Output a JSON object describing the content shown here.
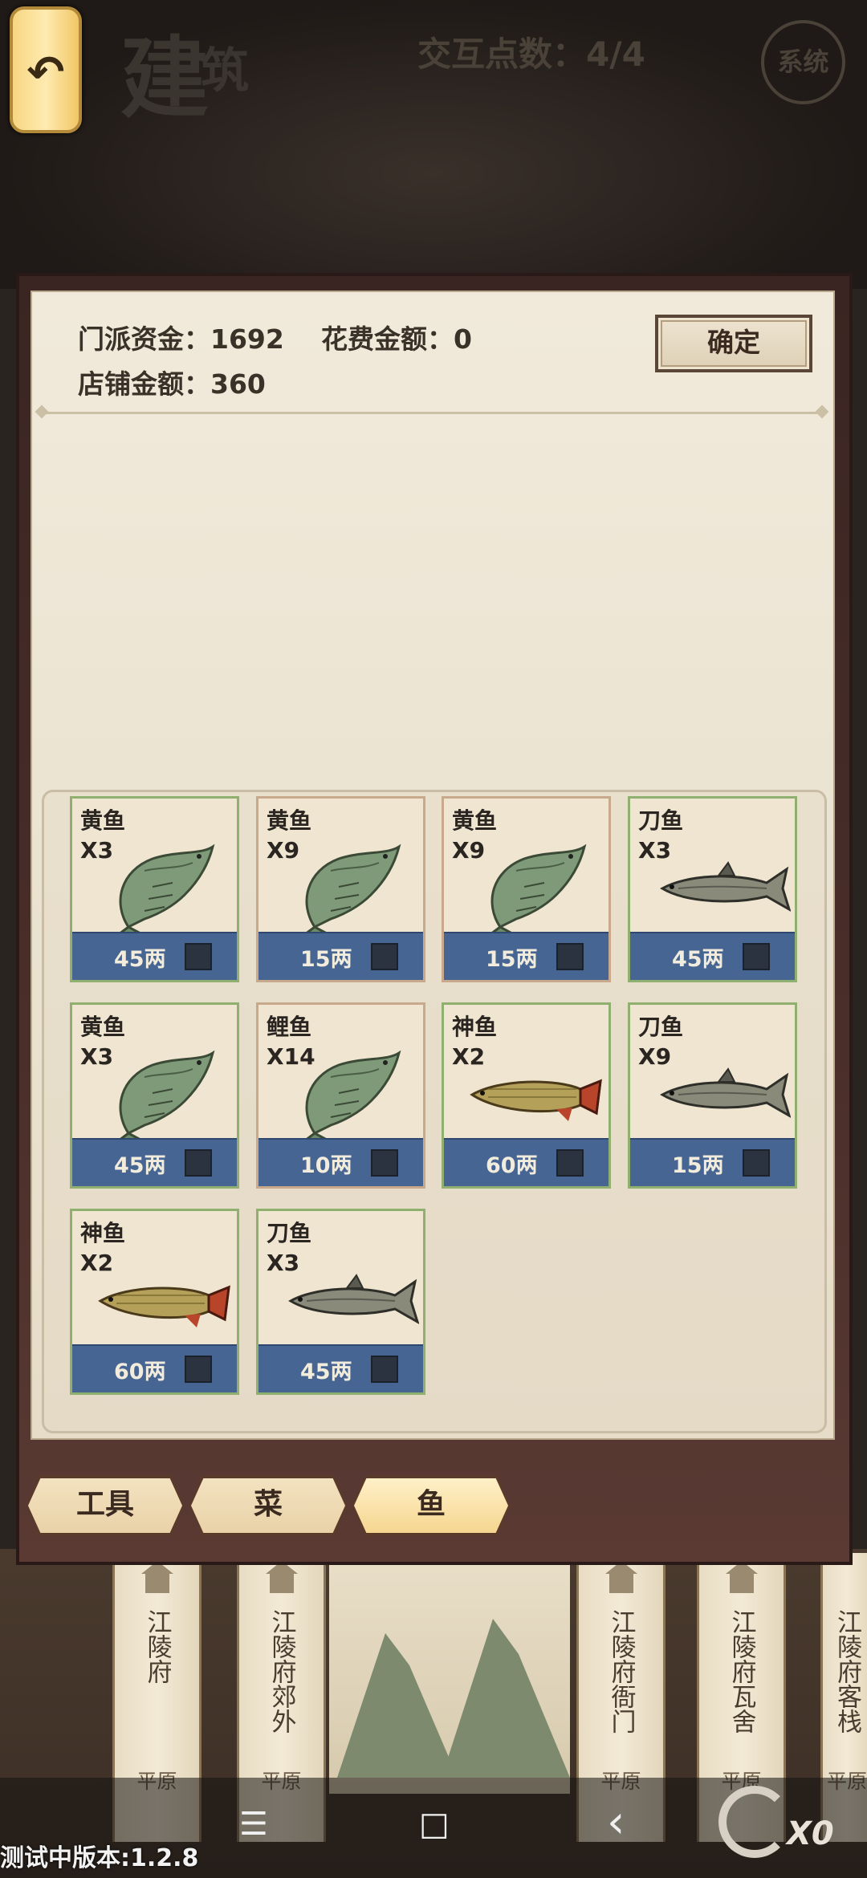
{
  "header": {
    "back_icon": "undo-arrow-icon",
    "title_main": "建",
    "title_sub": "筑",
    "interaction_points": "交互点数：4/4",
    "system_label": "系统"
  },
  "panel": {
    "sect_funds": "门派资金：1692",
    "spend_amount": "花费金额：0",
    "shop_amount": "店铺金额：360",
    "confirm_label": "确定"
  },
  "items": [
    {
      "name": "黄鱼",
      "qty": "X3",
      "price": "45两",
      "fish": "carp"
    },
    {
      "name": "黄鱼",
      "qty": "X9",
      "price": "15两",
      "fish": "carp"
    },
    {
      "name": "黄鱼",
      "qty": "X9",
      "price": "15两",
      "fish": "carp"
    },
    {
      "name": "刀鱼",
      "qty": "X3",
      "price": "45两",
      "fish": "sword"
    },
    {
      "name": "黄鱼",
      "qty": "X3",
      "price": "45两",
      "fish": "carp"
    },
    {
      "name": "鲤鱼",
      "qty": "X14",
      "price": "10两",
      "fish": "carp"
    },
    {
      "name": "神鱼",
      "qty": "X2",
      "price": "60两",
      "fish": "arowana"
    },
    {
      "name": "刀鱼",
      "qty": "X9",
      "price": "15两",
      "fish": "sword"
    },
    {
      "name": "神鱼",
      "qty": "X2",
      "price": "60两",
      "fish": "arowana"
    },
    {
      "name": "刀鱼",
      "qty": "X3",
      "price": "45两",
      "fish": "sword"
    }
  ],
  "tabs": [
    {
      "label": "工具",
      "active": false
    },
    {
      "label": "菜",
      "active": false
    },
    {
      "label": "鱼",
      "active": true
    }
  ],
  "map_columns": [
    {
      "name": "江陵府",
      "terrain": "平原"
    },
    {
      "name": "江陵府郊外",
      "terrain": "平原"
    },
    {
      "name": "江陵府衙门",
      "terrain": "平原"
    },
    {
      "name": "江陵府瓦舍",
      "terrain": "平原"
    },
    {
      "name": "江陵府客栈",
      "terrain": "平原"
    }
  ],
  "system_nav": {
    "menu_icon": "☰",
    "home_icon": "□",
    "back_icon": "‹"
  },
  "footer": {
    "version": "测试中版本:1.2.8",
    "refresh_count": "X0"
  }
}
